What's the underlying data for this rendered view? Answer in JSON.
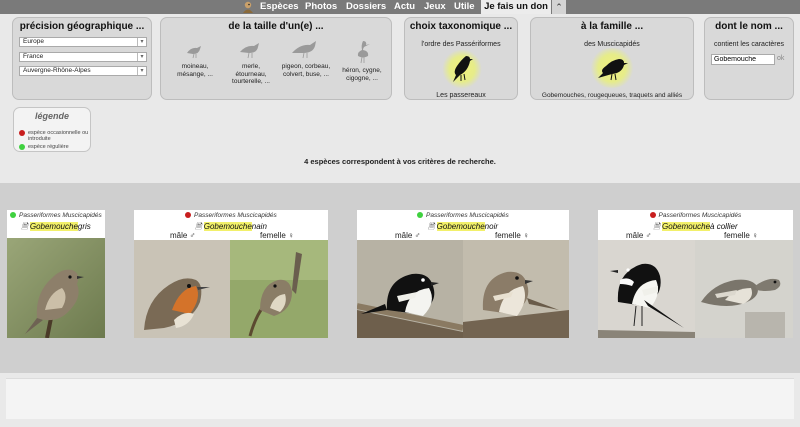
{
  "nav": {
    "items": [
      "Espèces",
      "Photos",
      "Dossiers",
      "Actu",
      "Jeux",
      "Utile"
    ],
    "donate": "Je fais un don",
    "caret": "⌃"
  },
  "geo": {
    "title": "précision géographique ...",
    "continent": "Europe",
    "country": "France",
    "region": "Auvergne-Rhône-Alpes"
  },
  "size": {
    "title": "de la taille d'un(e) ...",
    "options": [
      {
        "label": "moineau, mésange, ..."
      },
      {
        "label": "merle, étourneau, tourterelle, ..."
      },
      {
        "label": "pigeon, corbeau, colvert, buse, ..."
      },
      {
        "label": "héron, cygne, cigogne, ..."
      }
    ]
  },
  "taxo": {
    "title": "choix taxonomique ...",
    "order": "l'ordre des Passériformes",
    "common": "Les passereaux"
  },
  "family": {
    "title": "à la famille ...",
    "family": "des Muscicapidés",
    "members": "Gobemouches, rougequeues, traquets and alliés"
  },
  "name": {
    "title": "dont le nom ...",
    "contains": "contient les caractères",
    "value": "Gobemouche",
    "ok": "ok"
  },
  "legend": {
    "title": "légende",
    "occasional": "espèce occasionnelle ou introduite",
    "regular": "espèce régulière",
    "occasional_color": "#c81e1e",
    "regular_color": "#3fd13f"
  },
  "results": {
    "count_text": "4 espèces correspondent à vos critères de recherche.",
    "taxonomy": "Passeriformes Muscicapidés",
    "male": "mâle ♂",
    "female": "femelle ♀",
    "cards": [
      {
        "status": "regular",
        "highlight": "Gobemouche",
        "rest": "gris"
      },
      {
        "status": "occasional",
        "highlight": "Gobemouche",
        "rest": "nain"
      },
      {
        "status": "regular",
        "highlight": "Gobemouche",
        "rest": "noir"
      },
      {
        "status": "occasional",
        "highlight": "Gobemouche",
        "rest": "à collier"
      }
    ]
  }
}
